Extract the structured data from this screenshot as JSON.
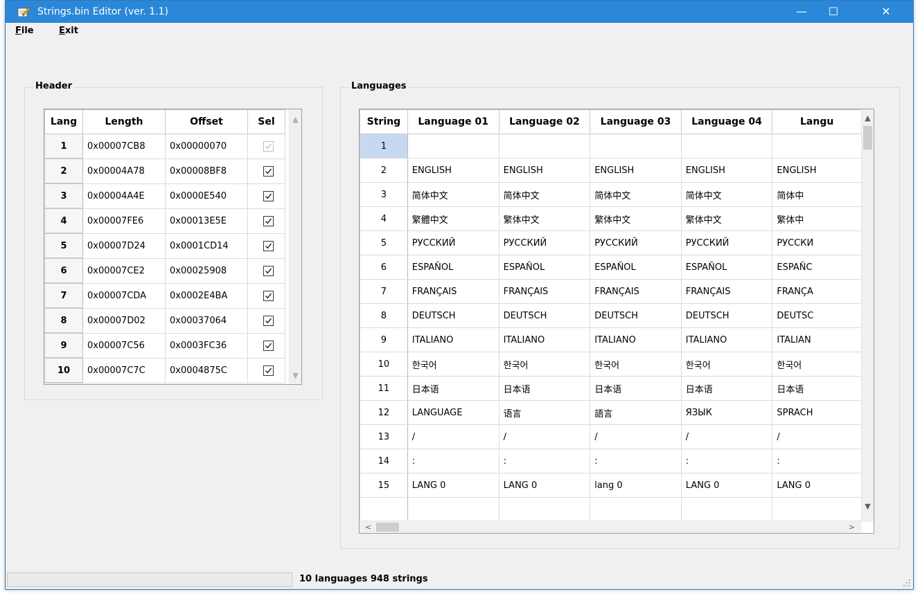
{
  "window": {
    "title": "Strings.bin Editor (ver. 1.1)",
    "min_glyph": "—",
    "max_glyph": "☐",
    "close_glyph": "✕"
  },
  "menu": {
    "file_first": "F",
    "file_rest": "ile",
    "exit_first": "E",
    "exit_rest": "xit"
  },
  "header_group": {
    "title": "Header",
    "columns": [
      "Lang",
      "Length",
      "Offset",
      "Sel"
    ],
    "rows": [
      {
        "lang": "1",
        "length": "0x00007CB8",
        "offset": "0x00000070",
        "sel": true,
        "disabled": true
      },
      {
        "lang": "2",
        "length": "0x00004A78",
        "offset": "0x00008BF8",
        "sel": true,
        "disabled": false
      },
      {
        "lang": "3",
        "length": "0x00004A4E",
        "offset": "0x0000E540",
        "sel": true,
        "disabled": false
      },
      {
        "lang": "4",
        "length": "0x00007FE6",
        "offset": "0x00013E5E",
        "sel": true,
        "disabled": false
      },
      {
        "lang": "5",
        "length": "0x00007D24",
        "offset": "0x0001CD14",
        "sel": true,
        "disabled": false
      },
      {
        "lang": "6",
        "length": "0x00007CE2",
        "offset": "0x00025908",
        "sel": true,
        "disabled": false
      },
      {
        "lang": "7",
        "length": "0x00007CDA",
        "offset": "0x0002E4BA",
        "sel": true,
        "disabled": false
      },
      {
        "lang": "8",
        "length": "0x00007D02",
        "offset": "0x00037064",
        "sel": true,
        "disabled": false
      },
      {
        "lang": "9",
        "length": "0x00007C56",
        "offset": "0x0003FC36",
        "sel": true,
        "disabled": false
      },
      {
        "lang": "10",
        "length": "0x00007C7C",
        "offset": "0x0004875C",
        "sel": true,
        "disabled": false
      }
    ]
  },
  "languages_group": {
    "title": "Languages",
    "columns": [
      "String",
      "Language 01",
      "Language 02",
      "Language 03",
      "Language 04",
      "Langu"
    ],
    "rows": [
      [
        "1",
        "",
        "",
        "",
        "",
        ""
      ],
      [
        "2",
        "ENGLISH",
        "ENGLISH",
        "ENGLISH",
        "ENGLISH",
        "ENGLISH"
      ],
      [
        "3",
        "简体中文",
        "简体中文",
        "简体中文",
        "简体中文",
        "简体中"
      ],
      [
        "4",
        "繁體中文",
        "繁体中文",
        "繁体中文",
        "繁体中文",
        "繁体中"
      ],
      [
        "5",
        "РУССКИЙ",
        "РУССКИЙ",
        "РУССКИЙ",
        "РУССКИЙ",
        "РУССКИ"
      ],
      [
        "6",
        "ESPAÑOL",
        "ESPAÑOL",
        "ESPAÑOL",
        "ESPAÑOL",
        "ESPAÑC"
      ],
      [
        "7",
        "FRANÇAIS",
        "FRANÇAIS",
        "FRANÇAIS",
        "FRANÇAIS",
        "FRANÇA"
      ],
      [
        "8",
        "DEUTSCH",
        "DEUTSCH",
        "DEUTSCH",
        "DEUTSCH",
        "DEUTSC"
      ],
      [
        "9",
        "ITALIANO",
        "ITALIANO",
        "ITALIANO",
        "ITALIANO",
        "ITALIAN"
      ],
      [
        "10",
        "한국어",
        "한국어",
        "한국어",
        "한국어",
        "한국어"
      ],
      [
        "11",
        "日本语",
        "日本语",
        "日本语",
        "日本语",
        "日本语"
      ],
      [
        "12",
        "LANGUAGE",
        "语言",
        "語言",
        "ЯЗЫК",
        "SPRACH"
      ],
      [
        "13",
        "/",
        "/",
        "/",
        "/",
        "/"
      ],
      [
        "14",
        ":",
        ":",
        ":",
        ":",
        ":"
      ],
      [
        "15",
        "LANG 0",
        "LANG 0",
        "lang 0",
        "LANG 0",
        "LANG 0"
      ],
      [
        "",
        "",
        "",
        "",
        "",
        ""
      ]
    ],
    "selected_row": "1"
  },
  "status": {
    "text": "10 languages  948 strings"
  },
  "icons": {
    "app": "notepad-pencil-icon",
    "checkbox": "checkbox-checked-icon",
    "scroll_up": "▲",
    "scroll_down": "▼",
    "scroll_left": "<",
    "scroll_right": ">"
  },
  "colors": {
    "titlebar": "#2b88d8",
    "selected_header": "#c6d9f1"
  }
}
